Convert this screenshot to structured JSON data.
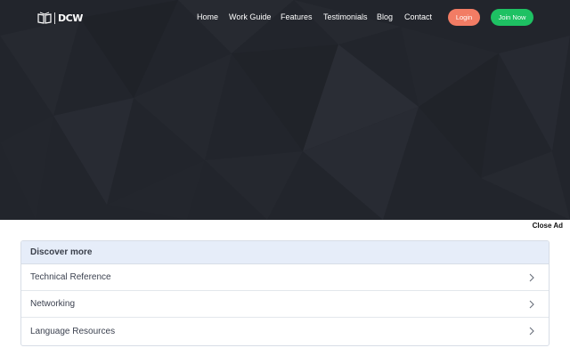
{
  "logo": {
    "text": "DCW"
  },
  "nav": {
    "links": [
      "Home",
      "Work Guide",
      "Features",
      "Testimonials",
      "Blog",
      "Contact"
    ],
    "login_label": "Login",
    "join_label": "Join Now"
  },
  "ad": {
    "close_label": "Close Ad"
  },
  "discover": {
    "title": "Discover more",
    "items": [
      "Technical Reference",
      "Networking",
      "Language Resources"
    ]
  },
  "colors": {
    "hero_bg": "#22252c",
    "login": "#f27c64",
    "join": "#1ec163",
    "discover_header": "#e6edf9"
  },
  "icons": {
    "logo": "book-icon",
    "chevron": "chevron-right-icon"
  }
}
